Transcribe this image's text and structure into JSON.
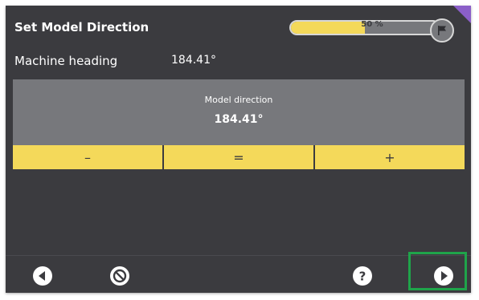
{
  "header": {
    "title": "Set Model Direction",
    "progress": {
      "percent": 0.5,
      "label": "50 %"
    }
  },
  "machine_heading": {
    "label": "Machine heading",
    "value": "184.41°"
  },
  "model_direction": {
    "label": "Model direction",
    "value": "184.41°"
  },
  "adjust_buttons": {
    "decrease": "–",
    "equal": "=",
    "increase": "+"
  },
  "footer": {
    "icons": [
      "back-icon",
      "cancel-icon",
      "help-icon",
      "next-icon"
    ]
  },
  "colors": {
    "background": "#3b3b3f",
    "panel": "#77787c",
    "accent_yellow": "#f4d95a",
    "corner_purple": "#8b5fc8",
    "highlight_green": "#1fa44a"
  }
}
